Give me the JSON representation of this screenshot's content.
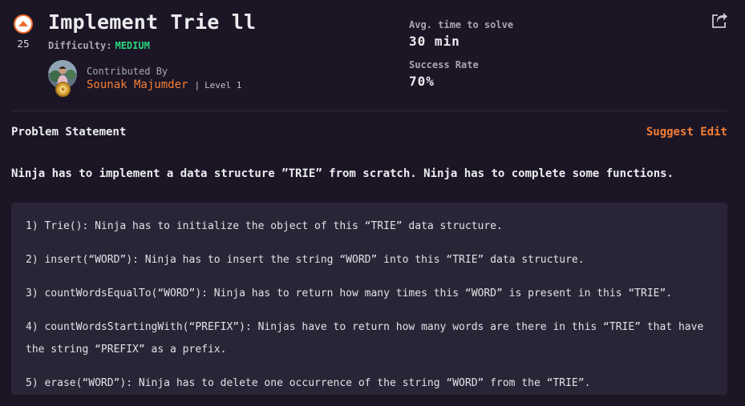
{
  "problem": {
    "title": "Implement Trie ll",
    "upvotes": "25",
    "difficulty_label": "Difficulty:",
    "difficulty_value": "MEDIUM",
    "contributed_by_label": "Contributed By",
    "contributor_name": "Sounak Majumder",
    "contributor_separator": "|",
    "contributor_level": "Level 1"
  },
  "stats": {
    "avg_time_label": "Avg. time to solve",
    "avg_time_value": "30 min",
    "success_rate_label": "Success Rate",
    "success_rate_value": "70%"
  },
  "section": {
    "title": "Problem Statement",
    "suggest_edit": "Suggest Edit"
  },
  "statement": {
    "intro": "Ninja has to implement a data structure ”TRIE” from scratch. Ninja has to complete some functions.",
    "functions": [
      "1) Trie(): Ninja has to initialize the object of this “TRIE” data structure.",
      "2) insert(“WORD”): Ninja has to insert the string “WORD”  into this “TRIE” data structure.",
      "3) countWordsEqualTo(“WORD”): Ninja has to return how many times this “WORD” is present in this “TRIE”.",
      "4) countWordsStartingWith(“PREFIX”): Ninjas have to return how many words are there in this “TRIE” that have the string “PREFIX” as a prefix.",
      "5) erase(“WORD”): Ninja has to delete one occurrence of the string “WORD” from the “TRIE”."
    ]
  },
  "icons": {
    "upvote": "upvote-arrow-icon",
    "share": "share-icon",
    "badge": "level-badge-icon"
  },
  "colors": {
    "background": "#1b1526",
    "accent": "#f57f35",
    "difficulty_medium": "#2bd67b",
    "panel": "#2a2536"
  }
}
